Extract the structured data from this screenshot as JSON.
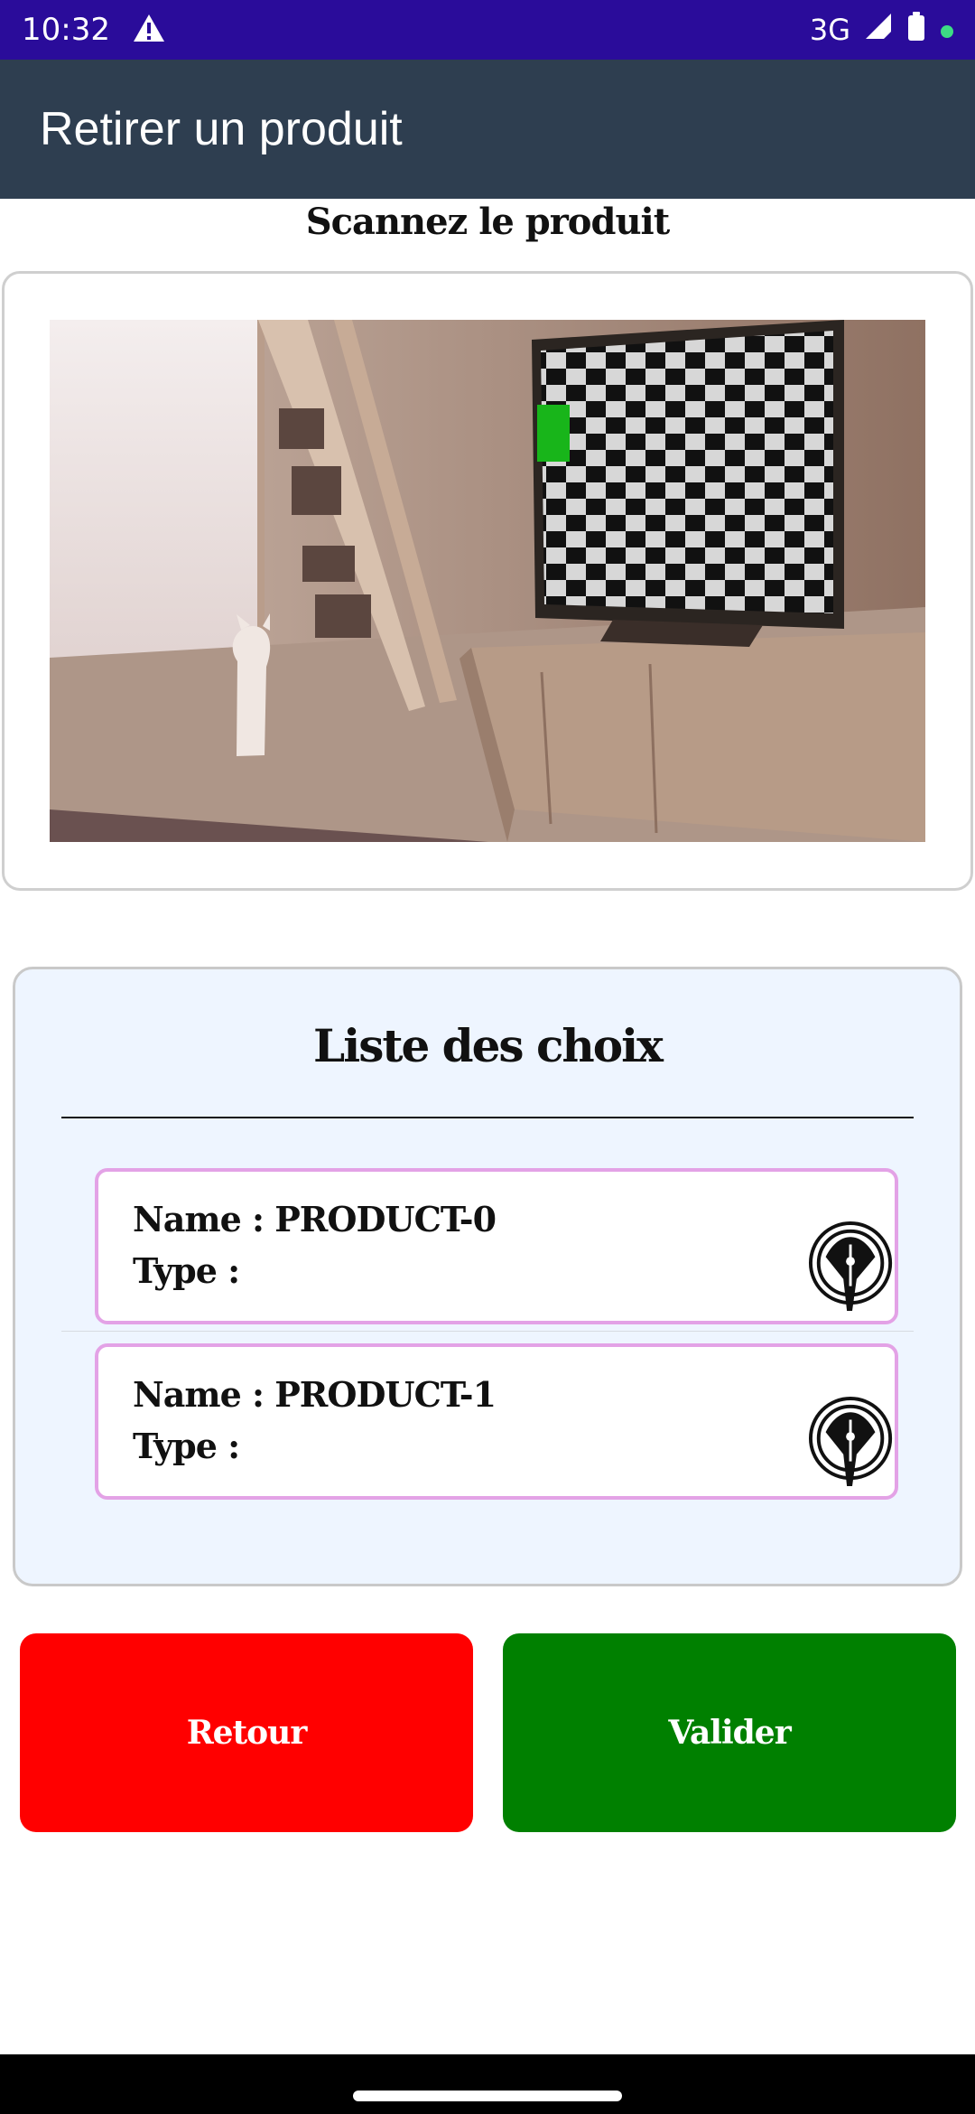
{
  "status_bar": {
    "time": "10:32",
    "network": "3G",
    "icons": [
      "warning-icon",
      "signal-icon",
      "battery-icon",
      "notification-dot-icon"
    ]
  },
  "app_bar": {
    "title": "Retirer un produit"
  },
  "scanner": {
    "title": "Scannez le produit"
  },
  "choices": {
    "title": "Liste des choix",
    "items": [
      {
        "name_label": "Name : PRODUCT-0",
        "type_label": "Type :",
        "icon": "fountain-pen-icon"
      },
      {
        "name_label": "Name : PRODUCT-1",
        "type_label": "Type :",
        "icon": "fountain-pen-icon"
      }
    ]
  },
  "buttons": {
    "back_label": "Retour",
    "validate_label": "Valider"
  },
  "colors": {
    "status_bar": "#2a0c9a",
    "app_bar": "#2e3e50",
    "choice_background": "#eef5ff",
    "card_border": "#e3a2e6",
    "back_button": "#ff0000",
    "validate_button": "#008000"
  }
}
